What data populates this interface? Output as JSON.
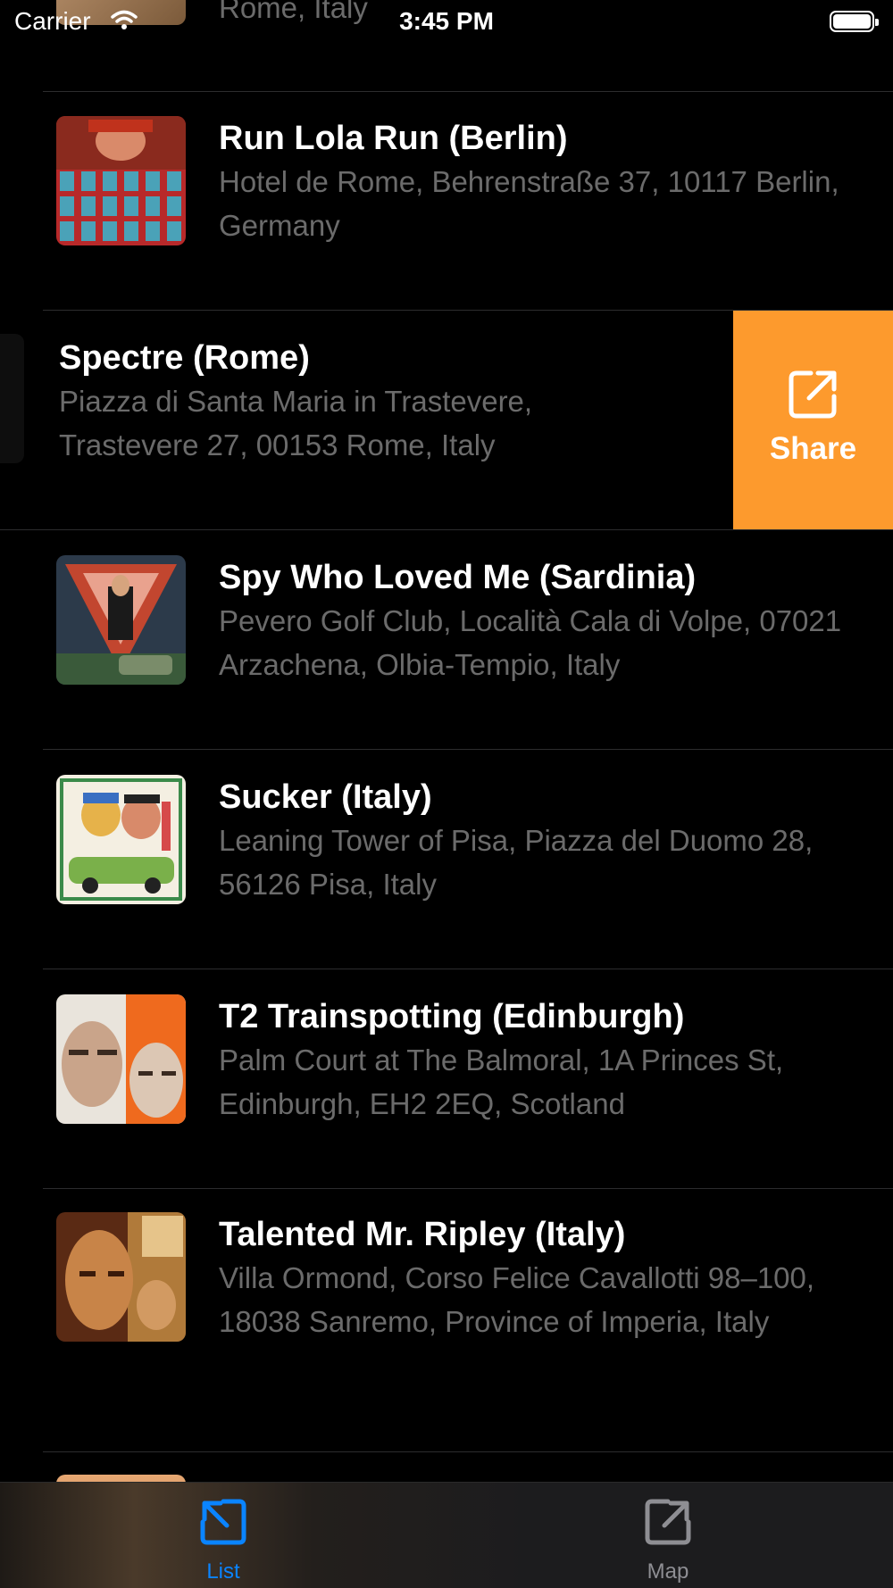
{
  "status_bar": {
    "carrier": "Carrier",
    "time": "3:45 PM"
  },
  "list": {
    "partial_top_subtitle": "Rome, Italy",
    "rows": [
      {
        "title": "Run Lola Run (Berlin)",
        "subtitle": "Hotel de Rome, Behrenstraße 37, 10117 Berlin, Germany"
      },
      {
        "title": "Spectre (Rome)",
        "subtitle": "Piazza di Santa Maria in Trastevere, Trastevere 27, 00153 Rome, Italy"
      },
      {
        "title": "Spy Who Loved Me (Sardinia)",
        "subtitle": "Pevero Golf Club, Località Cala di Volpe, 07021 Arzachena, Olbia-Tempio, Italy"
      },
      {
        "title": "Sucker (Italy)",
        "subtitle": "Leaning Tower of Pisa, Piazza del Duomo 28, 56126 Pisa, Italy"
      },
      {
        "title": "T2 Trainspotting (Edinburgh)",
        "subtitle": "Palm Court at The Balmoral, 1A Princes St, Edinburgh, EH2 2EQ, Scotland"
      },
      {
        "title": "Talented Mr. Ripley (Italy)",
        "subtitle": "Villa Ormond, Corso Felice Cavallotti 98–100, 18038 Sanremo, Province of Imperia, Italy"
      }
    ],
    "swipe_action": {
      "label": "Share",
      "icon": "share-icon",
      "color": "#fd9a2d"
    }
  },
  "tab_bar": {
    "tabs": [
      {
        "label": "List",
        "icon": "list-icon",
        "selected": true,
        "color": "#0a84ff"
      },
      {
        "label": "Map",
        "icon": "map-icon",
        "selected": false,
        "color": "#8e8e93"
      }
    ]
  }
}
